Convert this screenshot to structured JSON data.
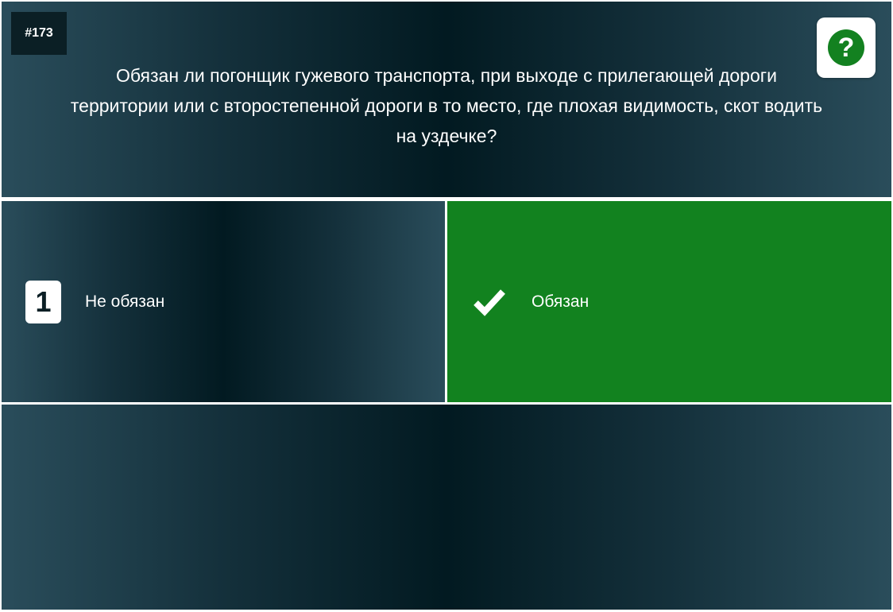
{
  "question": {
    "number": "#173",
    "text": "Обязан ли погонщик гужевого транспорта, при выходе с прилегающей дороги территории или с второстепенной дороги в то место, где плохая видимость, скот водить на уздечке?"
  },
  "help": {
    "symbol": "?",
    "icon": "help-icon"
  },
  "answers": [
    {
      "badge": "1",
      "label": "Не обязан",
      "state": "normal"
    },
    {
      "badge_icon": "checkmark-icon",
      "label": "Обязан",
      "state": "correct"
    }
  ],
  "colors": {
    "correct": "#12821f",
    "help_icon": "#138120",
    "panel_dark": "#021a21",
    "panel_edge": "#2a4d5b"
  }
}
